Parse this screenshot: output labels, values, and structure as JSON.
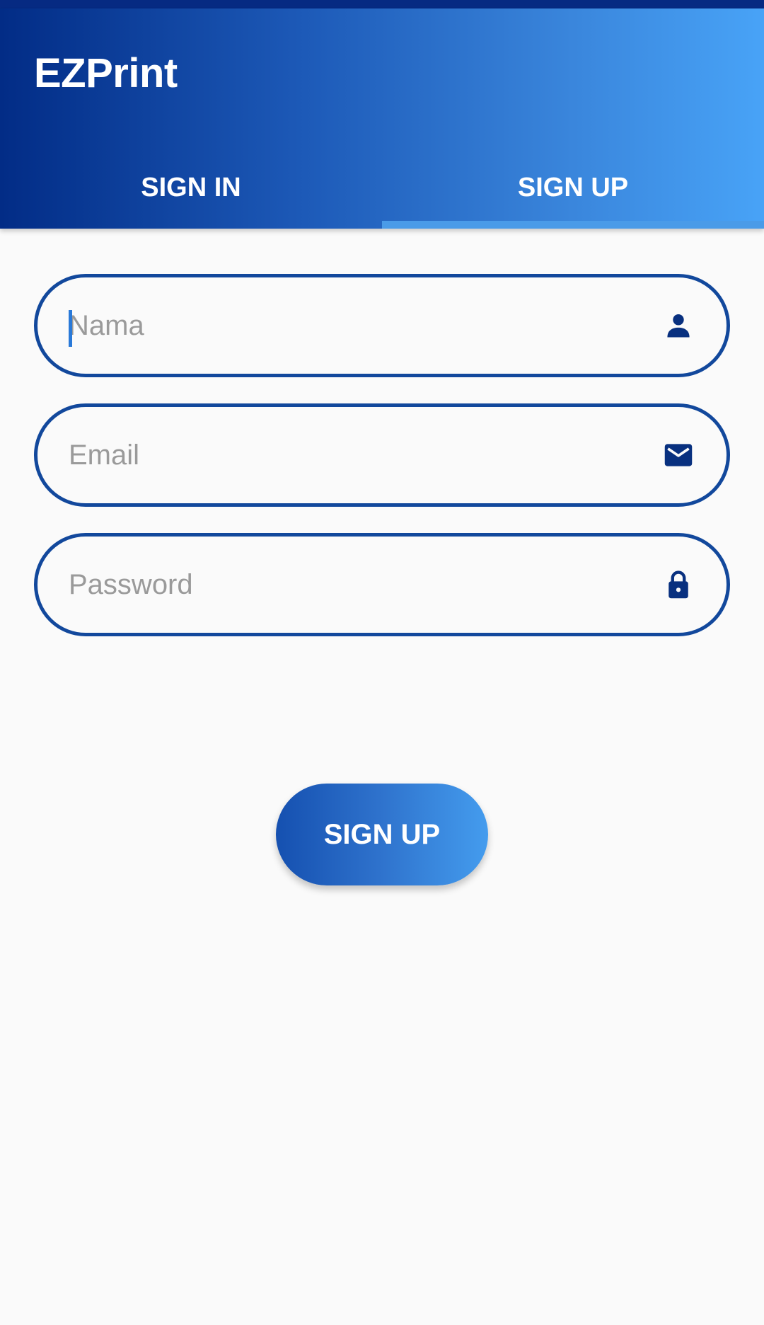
{
  "app_bar": {
    "title": "EZPrint"
  },
  "tabs": [
    {
      "label": "SIGN IN",
      "active": false
    },
    {
      "label": "SIGN UP",
      "active": true
    }
  ],
  "form": {
    "fields": [
      {
        "placeholder": "Nama",
        "value": "",
        "icon": "person-icon"
      },
      {
        "placeholder": "Email",
        "value": "",
        "icon": "mail-icon"
      },
      {
        "placeholder": "Password",
        "value": "",
        "icon": "lock-icon"
      }
    ],
    "submit_label": "SIGN UP"
  },
  "colors": {
    "primary": "#12489c",
    "gradient_start": "#022c86",
    "gradient_end": "#48a3f7",
    "tab_indicator": "#4a9be8",
    "background": "#fafafa",
    "placeholder": "#9a9a9a"
  }
}
